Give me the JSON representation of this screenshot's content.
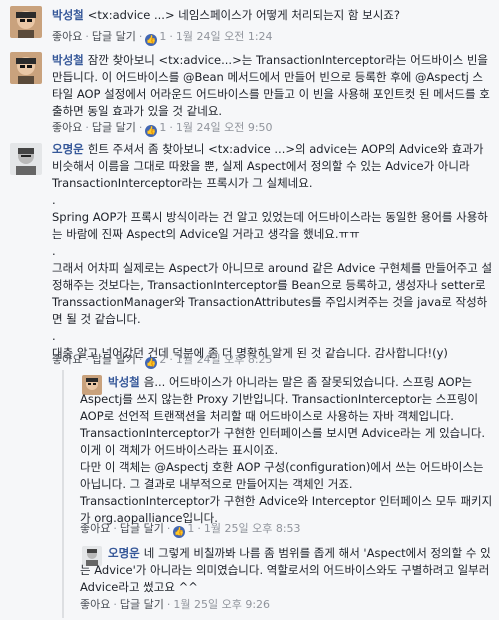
{
  "comments": [
    {
      "author": "박성철",
      "text": "<tx:advice ...> 네임스페이스가 어떻게 처리되는지 함 보시죠?",
      "like_label": "좋아요",
      "reply_label": "답글 달기",
      "like_count": "1",
      "timestamp": "1월 24일 오전 1:24"
    },
    {
      "author": "박성철",
      "text": "잠깐 찾아보니 <tx:advice...>는 TransactionInterceptor라는 어드바이스 빈을 만듭니다. 이 어드바이스를 @Bean 메서드에서 만들어 빈으로 등록한 후에 @Aspectj 스타일 AOP 설정에서 어라운드 어드바이스를 만들고 이 빈을 사용해 포인트컷 된 메서드를 호출하면 동일 효과가 있을 것 같네요.",
      "like_label": "좋아요",
      "reply_label": "답글 달기",
      "like_count": "1",
      "timestamp": "1월 24일 오전 9:50"
    },
    {
      "author": "오명운",
      "text": "힌트 주셔서 좀 찾아보니 <tx:advice ...>의 advice는 AOP의 Advice와 효과가 비슷해서 이름을 그대로 따왔을 뿐, 실제 Aspect에서 정의할 수 있는 Advice가 아니라 TransactionInterceptor라는 프록시가 그 실체네요.\n.\nSpring AOP가 프록시 방식이라는 건 알고 있었는데 어드바이스라는 동일한 용어를 사용하는 바람에 진짜 Aspect의 Advice일 거라고 생각을 했네요.ㅠㅠ\n.\n그래서 어차피 실제로는 Aspect가 아니므로 around 같은 Advice 구현체를 만들어주고 설정해주는 것보다는, TransactionInterceptor를 Bean으로 등록하고, 생성자나 setter로 TranssactionManager와 TransactionAttributes를 주입시켜주는 것을 java로 작성하면 될 것 같습니다.\n.\n대충 알고 넘어갔던 건데 덕분에 좀 더 명확히 알게 된 것 같습니다. 감사합니다!(y)",
      "like_label": "좋아요",
      "reply_label": "답글 달기",
      "like_count": "2",
      "timestamp": "1월 24일 오후 8:25"
    },
    {
      "author": "박성철",
      "text": "음... 어드바이스가 아니라는 말은 좀 잘못되었습니다. 스프링 AOP는 Aspectj를 쓰지 않는한 Proxy 기반입니다. TransactionInterceptor는 스프링이 AOP로 선언적 트랜잭션을 처리할 때 어드바이스로 사용하는 자바 객체입니다. TransactionInterceptor가 구현한 인터페이스를 보시면 Advice라는 게 있습니다. 이게 이 객체가 어드바이스라는 표시이죠.\n다만 이 객체는 @Aspectj 호환 AOP 구성(configuration)에서 쓰는 어드바이스는 아닙니다. 그 결과로 내부적으로 만들어지는 객체인 거죠.\nTransactionInterceptor가 구현한 Advice와 Interceptor 인터페이스 모두 패키지가 org.aopalliance입니다.",
      "like_label": "좋아요",
      "reply_label": "답글 달기",
      "like_count": "1",
      "timestamp": "1월 25일 오후 8:53"
    },
    {
      "author": "오명운",
      "text": "네 그렇게 비칠까봐 나름 좀 범위를 좁게 해서 'Aspect에서 정의할 수 있는 Advice'가 아니라는 의미였습니다. 역할로서의 어드바이스와도 구별하려고 일부러 Advice라고 썼고요 ^^",
      "like_label": "좋아요",
      "reply_label": "답글 달기",
      "like_count": "",
      "timestamp": "1월 25일 오후 9:26"
    }
  ]
}
